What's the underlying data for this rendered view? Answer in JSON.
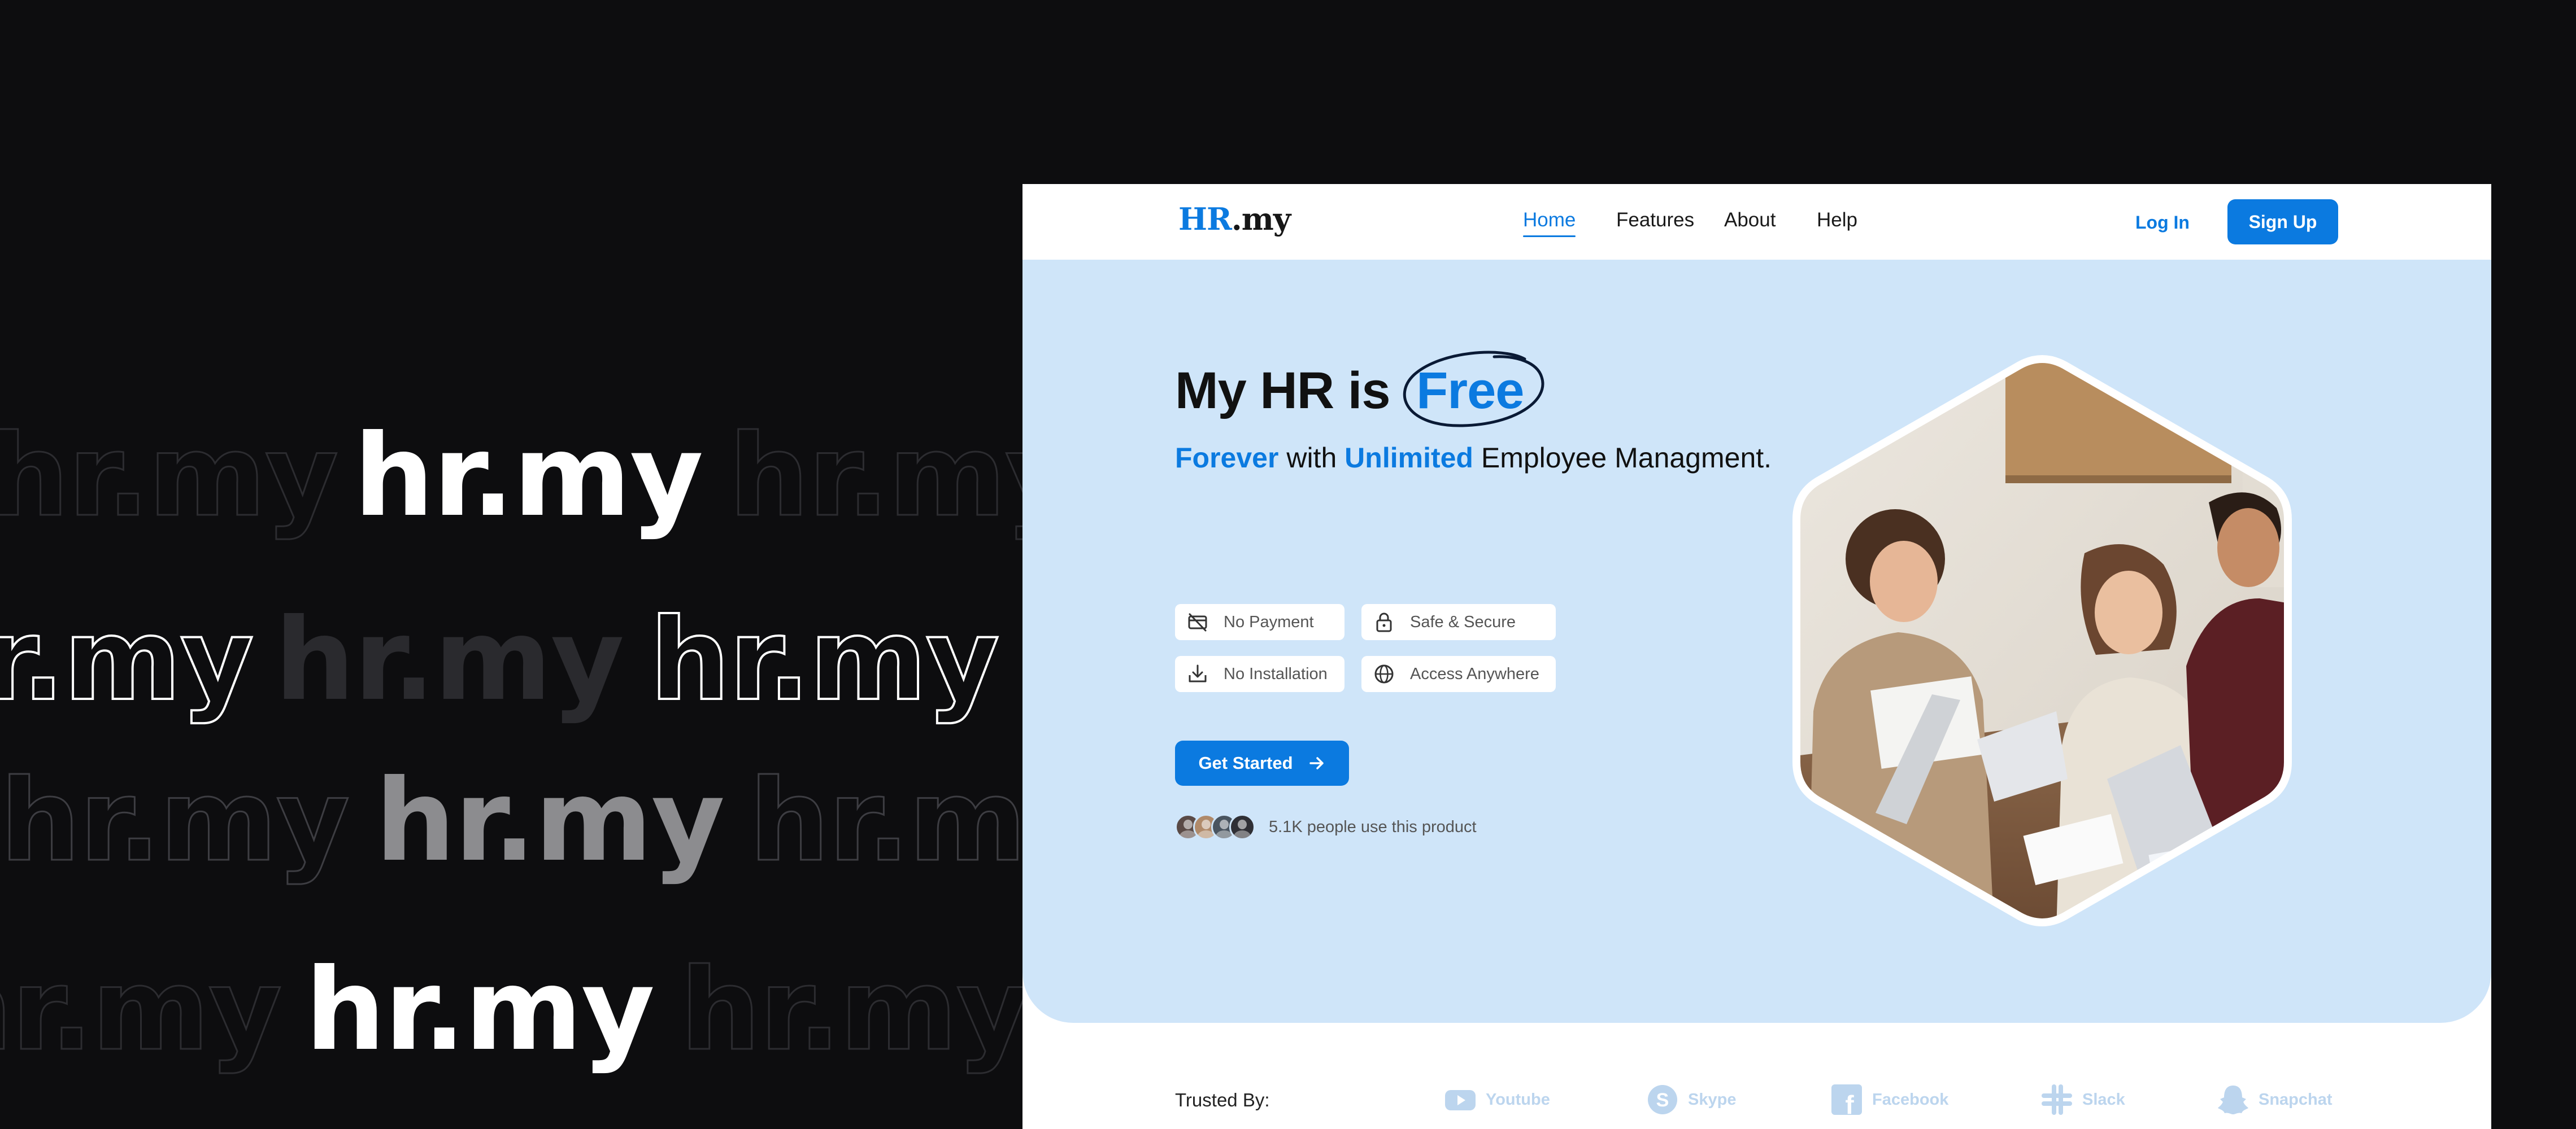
{
  "wordmark": "hr.my",
  "site": {
    "logo": {
      "hr": "HR",
      "rest": ".my"
    },
    "nav": {
      "links": [
        {
          "label": "Home",
          "active": true
        },
        {
          "label": "Features",
          "active": false
        },
        {
          "label": "About",
          "active": false
        },
        {
          "label": "Help",
          "active": false
        }
      ],
      "login_label": "Log In",
      "signup_label": "Sign Up"
    },
    "hero": {
      "title_prefix": "My HR is",
      "title_highlight": "Free",
      "subtitle_parts": [
        "Forever",
        "with",
        "Unlimited",
        "Employee Managment."
      ],
      "features": [
        {
          "label": "No Payment",
          "icon": "no-card-icon"
        },
        {
          "label": "Safe & Secure",
          "icon": "lock-icon"
        },
        {
          "label": "No Installation",
          "icon": "download-icon"
        },
        {
          "label": "Access Anywhere",
          "icon": "globe-icon"
        }
      ],
      "cta_label": "Get Started",
      "users_text": "5.1K people use this product",
      "avatar_colors": [
        "#5a4a46",
        "#b08a6a",
        "#4a5560",
        "#2f2f35"
      ]
    },
    "trusted": {
      "label": "Trusted By:",
      "brands": [
        {
          "name": "Youtube",
          "icon": "youtube-icon"
        },
        {
          "name": "Skype",
          "icon": "skype-icon"
        },
        {
          "name": "Facebook",
          "icon": "facebook-icon"
        },
        {
          "name": "Slack",
          "icon": "slack-icon"
        },
        {
          "name": "Snapchat",
          "icon": "snapchat-icon"
        }
      ]
    },
    "colors": {
      "accent": "#0b7ae0",
      "hero_bg": "#cfe5f9",
      "brand_muted": "#bcd5ee"
    }
  }
}
